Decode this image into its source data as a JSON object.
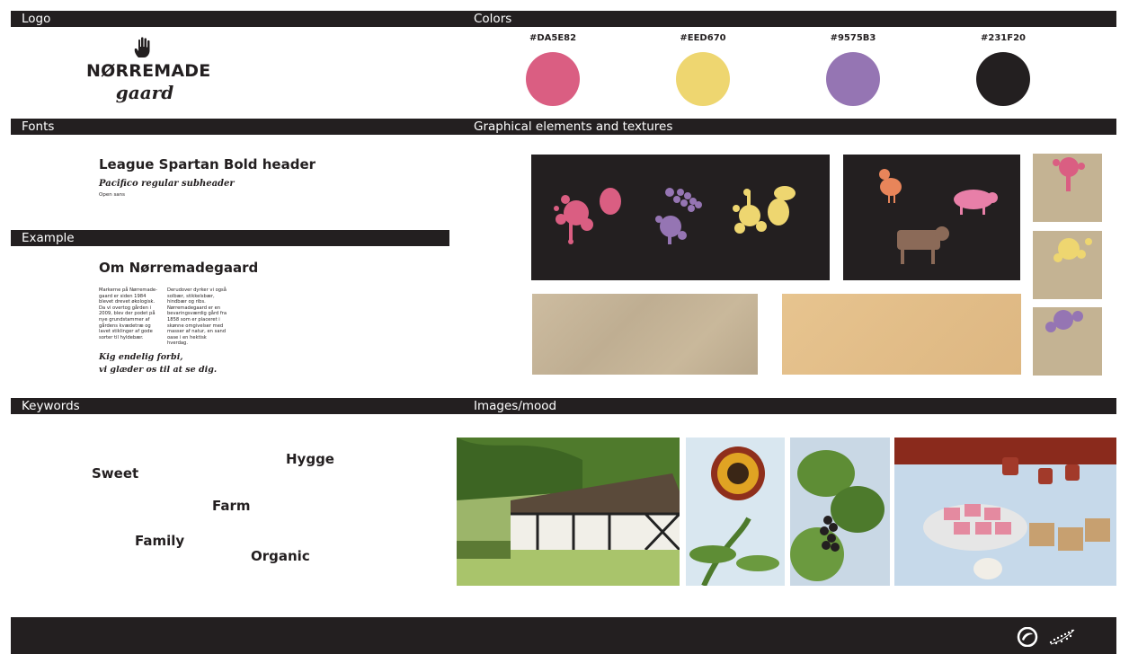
{
  "sections": {
    "logo": "Logo",
    "colors": "Colors",
    "fonts": "Fonts",
    "graphics": "Graphical elements and textures",
    "example": "Example",
    "keywords": "Keywords",
    "images": "Images/mood"
  },
  "logo": {
    "name": "NØRREMADE",
    "sub": "gaard"
  },
  "colors": [
    {
      "hex": "#DA5E82"
    },
    {
      "hex": "#EED670"
    },
    {
      "hex": "#9575B3"
    },
    {
      "hex": "#231F20"
    }
  ],
  "fonts": {
    "header": "League Spartan Bold header",
    "subheader": "Pacifico regular subheader",
    "body": "Open sans"
  },
  "example": {
    "title": "Om Nørremadegaard",
    "col1": "Markerne på Nørremade-gaard er siden 1984 blevet drevet økologisk. Da vi overtog gården i 2009, blev der podet på nye grundstammer af gårdens kvædetræ og lavet stiklinger af gode sorter til hyldebær.",
    "col2": "Derudover dyrker vi også solbær, stikkelsbær, hindbær og ribs. Nørremadegaard er en bevaringsværdig gård fra 1858 som er placeret i skønne omgivelser med masser af natur, en sand oase i en hektisk hverdag.",
    "quote1": "Kig endelig forbi,",
    "quote2": "vi glæder os til at se dig."
  },
  "keywords": [
    "Hygge",
    "Sweet",
    "Farm",
    "Family",
    "Organic"
  ],
  "icons": [
    "hand-icon",
    "organic-leaf-icon",
    "eu-organic-icon",
    "paint-splat-icon",
    "berry-icon",
    "chicken-icon",
    "pig-icon",
    "cow-icon"
  ]
}
